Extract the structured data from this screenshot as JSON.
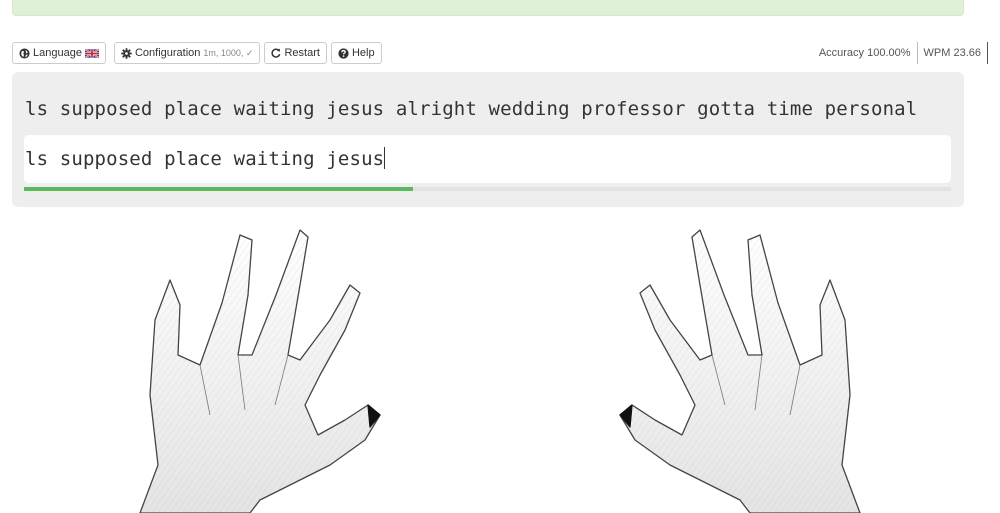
{
  "toolbar": {
    "language_label": "Language",
    "language_flag": "uk-flag-icon",
    "configuration_label": "Configuration",
    "configuration_detail": "1m, 1000, ✓",
    "restart_label": "Restart",
    "help_label": "Help"
  },
  "stats": {
    "accuracy": "Accuracy 100.00%",
    "wpm": "WPM 23.66"
  },
  "exercise": {
    "target_text": "ls supposed place waiting jesus alright wedding professor gotta time personal",
    "typed_text": "ls supposed place waiting jesus",
    "progress_fraction": 0.42
  },
  "colors": {
    "alert_bg": "#dff0d8",
    "panel_bg": "#eeeeee",
    "progress": "#5cb85c"
  },
  "icons": [
    "globe-icon",
    "uk-flag-icon",
    "gear-icon",
    "refresh-icon",
    "question-circle-icon"
  ]
}
